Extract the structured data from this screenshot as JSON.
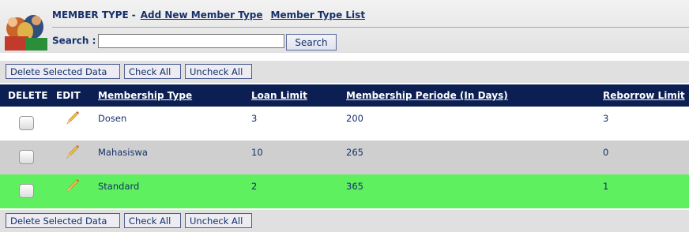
{
  "header": {
    "title": "MEMBER TYPE",
    "separator": "-",
    "add_link": "Add New Member Type",
    "list_link": "Member Type List"
  },
  "search": {
    "label": "Search :",
    "value": "",
    "button": "Search"
  },
  "actions": {
    "delete_selected": "Delete Selected Data",
    "check_all": "Check All",
    "uncheck_all": "Uncheck All"
  },
  "table": {
    "columns": [
      "DELETE",
      "EDIT",
      "Membership Type",
      "Loan Limit",
      "Membership Periode (In Days)",
      "Reborrow Limit"
    ],
    "rows": [
      {
        "type": "Dosen",
        "loan_limit": "3",
        "period": "200",
        "reborrow": "3",
        "checked": false
      },
      {
        "type": "Mahasiswa",
        "loan_limit": "10",
        "period": "265",
        "reborrow": "0",
        "checked": false
      },
      {
        "type": "Standard",
        "loan_limit": "2",
        "period": "365",
        "reborrow": "1",
        "checked": false
      }
    ]
  },
  "colors": {
    "header_bar": "#0b1f52",
    "text": "#15306b",
    "row_alt": "#cfcfcf",
    "row_highlight": "#5ff05f"
  },
  "icons": {
    "logo": "members-logo-icon",
    "edit": "pencil-icon"
  }
}
